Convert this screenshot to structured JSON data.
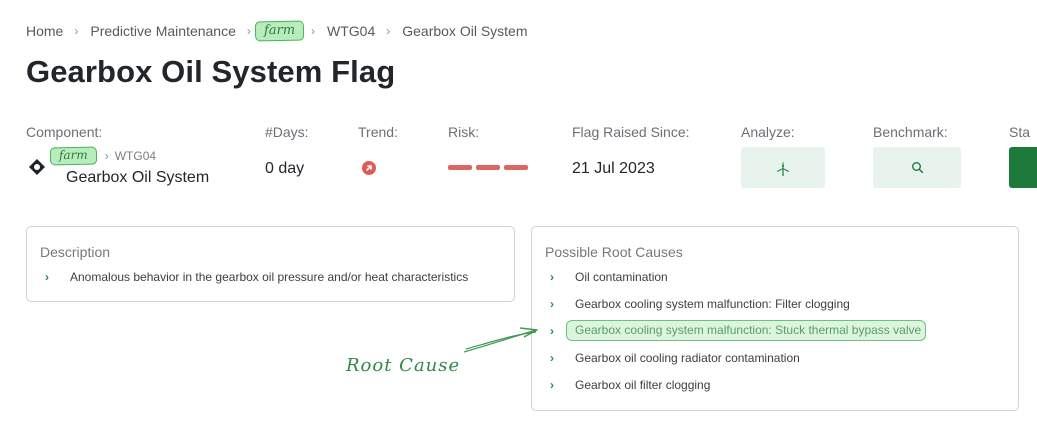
{
  "breadcrumb": {
    "items": [
      "Home",
      "Predictive Maintenance",
      "farm",
      "WTG04",
      "Gearbox Oil System"
    ]
  },
  "page_title": "Gearbox Oil System Flag",
  "info": {
    "component_label": "Component:",
    "component_path_farm": "farm",
    "component_path_turbine": "WTG04",
    "component_name": "Gearbox Oil System",
    "days_label": "#Days:",
    "days_value": "0 day",
    "trend_label": "Trend:",
    "risk_label": "Risk:",
    "risk_level_segments": 3,
    "flag_label": "Flag Raised Since:",
    "flag_value": "21 Jul 2023",
    "analyze_label": "Analyze:",
    "analyze_icon": "wind-turbine-icon",
    "benchmark_label": "Benchmark:",
    "benchmark_icon": "search-icon",
    "status_label": "Sta"
  },
  "description": {
    "title": "Description",
    "items": [
      "Anomalous behavior in the gearbox oil pressure and/or heat characteristics"
    ]
  },
  "root_causes": {
    "title": "Possible Root Causes",
    "items": [
      "Oil contamination",
      "Gearbox cooling system malfunction: Filter clogging",
      "Gearbox cooling system malfunction: Stuck thermal bypass valve",
      "Gearbox oil cooling radiator contamination",
      "Gearbox oil filter clogging"
    ],
    "highlighted_index": 2
  },
  "annotation": {
    "label": "Root Cause"
  },
  "colors": {
    "accent_green": "#1d7a3a",
    "risk_red": "#df6464",
    "button_bg": "#e7f3ec",
    "highlight_green": "#6bc37b"
  }
}
